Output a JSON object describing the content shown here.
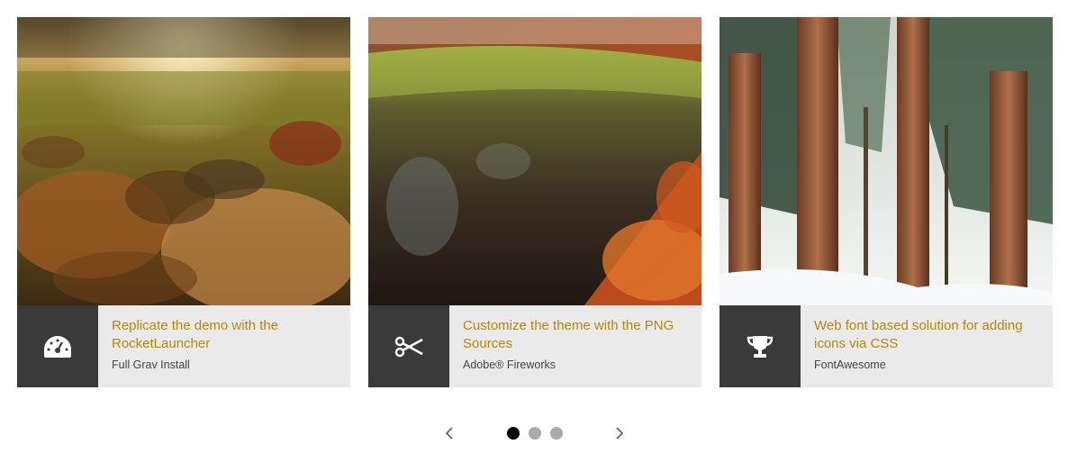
{
  "colors": {
    "accent": "#b8860b",
    "icon_box": "#3a3a3a",
    "caption_bg": "#eaeaea",
    "subtitle": "#444444",
    "dot_active": "#000000",
    "dot_inactive": "#aaaaaa",
    "arrow": "#666666"
  },
  "cards": [
    {
      "image": "autumn-leaves-photo",
      "icon": "speedometer-icon",
      "title": "Replicate the demo with the RocketLauncher",
      "subtitle": "Full Grav Install"
    },
    {
      "image": "mossy-log-photo",
      "icon": "scissors-icon",
      "title": "Customize the theme with the PNG Sources",
      "subtitle": "Adobe® Fireworks"
    },
    {
      "image": "snowy-forest-photo",
      "icon": "trophy-icon",
      "title": "Web font based solution for adding icons via CSS",
      "subtitle": "FontAwesome"
    }
  ],
  "pager": {
    "prev_icon": "chevron-left-icon",
    "next_icon": "chevron-right-icon",
    "pages": 3,
    "active_page": 1
  }
}
